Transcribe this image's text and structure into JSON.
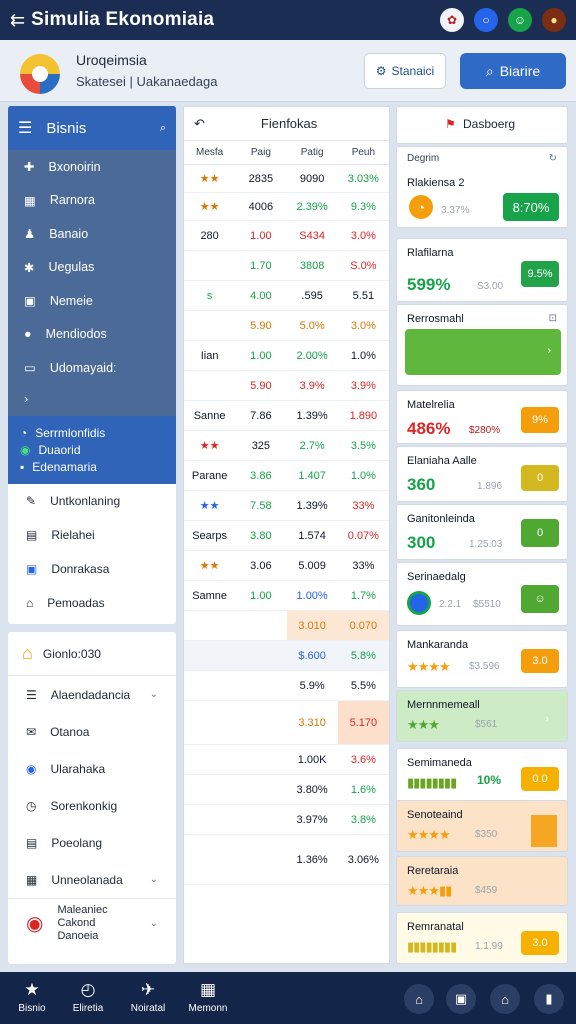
{
  "app": {
    "title": "Simulia Ekonomiaia",
    "menu_icon": "back-arrow-icon"
  },
  "header": {
    "line1": "Uroqeimsia",
    "line2": "Skatesei  |  Uakanaedaga",
    "btn_white": "Stanaici",
    "btn_blue": "Biarire"
  },
  "sidebar": {
    "head": "Bisnis",
    "items": [
      {
        "label": "Bxonoirin",
        "icon": "puzzle-icon"
      },
      {
        "label": "Rarnora",
        "icon": "building-icon"
      },
      {
        "label": "Banaio",
        "icon": "person-icon"
      },
      {
        "label": "Uegulas",
        "icon": "settings-icon"
      },
      {
        "label": "Nemeie",
        "icon": "chart-icon"
      },
      {
        "label": "Mendiodos",
        "icon": "circle-icon"
      },
      {
        "label": "Udomayaid:",
        "icon": "card-icon"
      }
    ],
    "selected": [
      "Serrmlonfidis",
      "Duaorid",
      "Edenamaria"
    ],
    "lower": [
      "Untkonlaning",
      "Rielahei",
      "Donrakasa",
      "Pemoadas"
    ]
  },
  "sidebar2": {
    "top": "Gionlo:030",
    "items": [
      "Alaendadancia",
      "Otanoa",
      "Ularahaka",
      "Sorenkonkig",
      "Poeolang",
      "Unneolanada"
    ],
    "bottom": "Maleaniec Cakond Danoeia"
  },
  "table": {
    "title": "Fienfokas",
    "cols": [
      "Mesfa",
      "Paig",
      "Patig",
      "Peuh"
    ],
    "rows": [
      [
        "★★",
        "2835",
        "9090",
        "3.03%"
      ],
      [
        "★★",
        "4006",
        "2.39%",
        "9.3%"
      ],
      [
        "280",
        "1.00",
        "S434",
        "3.0%"
      ],
      [
        "",
        "1.70",
        "3808",
        "S.0%"
      ],
      [
        "s",
        "4.00",
        ".595",
        "5.51"
      ],
      [
        "",
        "5.90",
        "5.0%",
        "3.0%"
      ],
      [
        "Iian",
        "1.00",
        "2.00%",
        "1.0%"
      ],
      [
        "",
        "5.90",
        "3.9%",
        "3.9%"
      ],
      [
        "Sanne",
        "7.86",
        "1.39%",
        "1.890"
      ],
      [
        "★★",
        "325",
        "2.7%",
        "3.5%"
      ],
      [
        "Parane",
        "3.86",
        "1.407",
        "1.0%"
      ],
      [
        "★★",
        "7.58",
        "1.39%",
        "33%"
      ],
      [
        "Searps",
        "3.80",
        "1.574",
        "0.07%"
      ],
      [
        "★★",
        "3.06",
        "5.009",
        "33%"
      ],
      [
        "Samne",
        "1.00",
        "1.00%",
        "1.7%"
      ],
      [
        "",
        "",
        "3.010",
        "0.070"
      ],
      [
        "",
        "",
        "$.600",
        "5.8%"
      ],
      [
        "",
        "",
        "5.9%",
        "5.5%"
      ],
      [
        "",
        "",
        "3.310",
        "5.170"
      ],
      [
        "",
        "",
        "1.00K",
        "3.6%"
      ],
      [
        "",
        "",
        "3.80%",
        "1.6%"
      ],
      [
        "",
        "",
        "3.97%",
        "3.8%"
      ],
      [
        "",
        "",
        "1.36%",
        "3.06%"
      ]
    ]
  },
  "cards": [
    {
      "title": "Dasboerg"
    },
    {
      "title": "Rlakiensa 2",
      "sub": "3.37%",
      "pill": "8:70%"
    },
    {
      "title": "Rlafilarna",
      "big": "599%",
      "sub": "S3.00",
      "pill": "9.5%"
    },
    {
      "title": "Rerrosmahl"
    },
    {
      "title": "Matelrelia",
      "big": "486%",
      "sub": "$280%",
      "pill": "9%"
    },
    {
      "title": "Elaniaha Aalle",
      "big": "360",
      "sub": "1.896",
      "pill": "0"
    },
    {
      "title": "Ganitonleinda",
      "big": "300",
      "sub": "1.25.03",
      "pill": "0"
    },
    {
      "title": "Serinaedalg",
      "sub": "2.2.1",
      "sub2": "$5510"
    },
    {
      "title": "Mankaranda",
      "sub": "$3.596",
      "pill": "3.0"
    },
    {
      "title": "Mernnmemeall",
      "sub": "$561"
    },
    {
      "title": "Semimaneda",
      "big": "10%",
      "pill": "0.0"
    },
    {
      "title": "Senoteaind",
      "sub": "$350"
    },
    {
      "title": "Reretaraia",
      "sub": "$459"
    },
    {
      "title": "Remranatal",
      "sub": "1.1.99",
      "pill": "3.0"
    }
  ],
  "bottomnav": [
    "Bisnio",
    "Eliretia",
    "Noiratal",
    "Memonn"
  ]
}
